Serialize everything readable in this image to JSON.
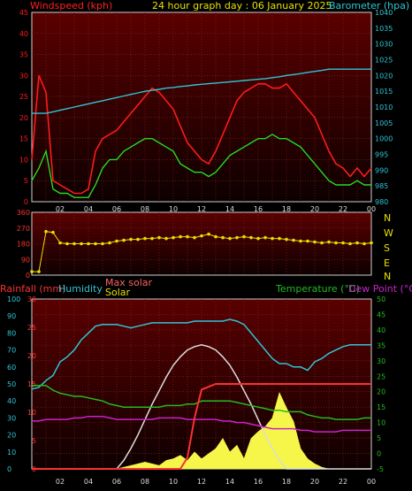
{
  "header": {
    "left_title": "Windspeed (kph)",
    "center_title": "24 hour graph day : 06 January 2025",
    "right_title": "Barometer (hpa)"
  },
  "colors": {
    "wind_gust": "#ff1a1a",
    "wind_avg": "#22dd22",
    "barometer": "#2fc4d4",
    "direction": "#e8e000",
    "rain": "#ff3030",
    "humidity": "#2fc4d4",
    "max_solar": "#dddddd",
    "solar": "#f5f54a",
    "temperature": "#22bb22",
    "dewpoint": "#cc22cc",
    "panel_top": "#5a0000",
    "panel_bottom": "#0d0000"
  },
  "time_axis": {
    "labels": [
      "02",
      "04",
      "06",
      "08",
      "10",
      "12",
      "14",
      "16",
      "18",
      "20",
      "22",
      "00"
    ]
  },
  "panel_wind": {
    "left_ticks": [
      "45",
      "40",
      "35",
      "30",
      "25",
      "20",
      "15",
      "10",
      "5",
      "0"
    ],
    "right_ticks": [
      "1040",
      "1035",
      "1030",
      "1025",
      "1020",
      "1015",
      "1010",
      "1005",
      "1000",
      "995",
      "990",
      "985",
      "980"
    ]
  },
  "panel_direction": {
    "left_ticks": [
      "360",
      "270",
      "180",
      "90",
      "0"
    ],
    "compass": [
      "N",
      "W",
      "S",
      "E",
      "N"
    ]
  },
  "panel_lower": {
    "labels": {
      "rainfall": "Rainfall (mm)",
      "humidity": "Humidity",
      "max_solar": "Max solar",
      "solar": "Solar",
      "temperature": "Temperature (°C)",
      "dewpoint": "Dew Point (°C)"
    },
    "humidity_ticks": [
      "100",
      "90",
      "80",
      "70",
      "60",
      "50",
      "40",
      "30",
      "20",
      "10",
      "0"
    ],
    "rain_ticks": [
      "30",
      "25",
      "20",
      "15",
      "10",
      "5",
      "0"
    ],
    "temp_ticks": [
      "50",
      "45",
      "40",
      "35",
      "30",
      "25",
      "20",
      "15",
      "10",
      "5",
      "0",
      "-5"
    ]
  },
  "chart_data": [
    {
      "type": "line",
      "title": "Windspeed (kph) / Barometer (hpa)",
      "x_hours": [
        0,
        0.5,
        1,
        1.5,
        2,
        2.5,
        3,
        3.5,
        4,
        4.5,
        5,
        5.5,
        6,
        6.5,
        7,
        7.5,
        8,
        8.5,
        9,
        9.5,
        10,
        10.5,
        11,
        11.5,
        12,
        12.5,
        13,
        13.5,
        14,
        14.5,
        15,
        15.5,
        16,
        16.5,
        17,
        17.5,
        18,
        18.5,
        19,
        19.5,
        20,
        20.5,
        21,
        21.5,
        22,
        22.5,
        23,
        23.5,
        24
      ],
      "series": [
        {
          "name": "Wind gust",
          "axis": "left",
          "values": [
            10,
            30,
            26,
            5,
            4,
            3,
            2,
            2,
            3,
            12,
            15,
            16,
            17,
            19,
            21,
            23,
            25,
            27,
            26,
            24,
            22,
            18,
            14,
            12,
            10,
            9,
            12,
            16,
            20,
            24,
            26,
            27,
            28,
            28,
            27,
            27,
            28,
            26,
            24,
            22,
            20,
            16,
            12,
            9,
            8,
            6,
            8,
            6,
            8
          ]
        },
        {
          "name": "Wind average",
          "axis": "left",
          "values": [
            5,
            8,
            12,
            3,
            2,
            2,
            1,
            1,
            1,
            4,
            8,
            10,
            10,
            12,
            13,
            14,
            15,
            15,
            14,
            13,
            12,
            9,
            8,
            7,
            7,
            6,
            7,
            9,
            11,
            12,
            13,
            14,
            15,
            15,
            16,
            15,
            15,
            14,
            13,
            11,
            9,
            7,
            5,
            4,
            4,
            4,
            5,
            4,
            4
          ]
        },
        {
          "name": "Barometer",
          "axis": "right",
          "values": [
            1008,
            1008,
            1008,
            1008.5,
            1009,
            1009.5,
            1010,
            1010.5,
            1011,
            1011.5,
            1012,
            1012.5,
            1013,
            1013.5,
            1014,
            1014.5,
            1015,
            1015.3,
            1015.6,
            1016,
            1016.2,
            1016.5,
            1016.7,
            1017,
            1017.2,
            1017.4,
            1017.6,
            1017.8,
            1018,
            1018.2,
            1018.4,
            1018.6,
            1018.8,
            1019,
            1019.3,
            1019.6,
            1020,
            1020.3,
            1020.6,
            1021,
            1021.3,
            1021.6,
            1022,
            1022,
            1022,
            1022,
            1022,
            1022,
            1022
          ]
        }
      ],
      "ylim_left": [
        0,
        45
      ],
      "ylim_right": [
        980,
        1040
      ]
    },
    {
      "type": "scatter",
      "title": "Wind direction",
      "x_hours": [
        0,
        0.5,
        1,
        1.5,
        2,
        2.5,
        3,
        3.5,
        4,
        4.5,
        5,
        5.5,
        6,
        6.5,
        7,
        7.5,
        8,
        8.5,
        9,
        9.5,
        10,
        10.5,
        11,
        11.5,
        12,
        12.5,
        13,
        13.5,
        14,
        14.5,
        15,
        15.5,
        16,
        16.5,
        17,
        17.5,
        18,
        18.5,
        19,
        19.5,
        20,
        20.5,
        21,
        21.5,
        22,
        22.5,
        23,
        23.5,
        24
      ],
      "values": [
        20,
        20,
        250,
        245,
        185,
        180,
        180,
        180,
        180,
        180,
        180,
        185,
        195,
        200,
        205,
        205,
        210,
        210,
        215,
        210,
        215,
        220,
        220,
        215,
        225,
        235,
        220,
        215,
        210,
        215,
        220,
        215,
        210,
        215,
        210,
        210,
        205,
        200,
        195,
        195,
        190,
        185,
        190,
        185,
        185,
        180,
        185,
        180,
        185
      ],
      "ylim": [
        0,
        360
      ]
    },
    {
      "type": "line",
      "title": "Rainfall / Humidity / Solar / Temperature / Dew Point",
      "x_hours": [
        0,
        0.5,
        1,
        1.5,
        2,
        2.5,
        3,
        3.5,
        4,
        4.5,
        5,
        5.5,
        6,
        6.5,
        7,
        7.5,
        8,
        8.5,
        9,
        9.5,
        10,
        10.5,
        11,
        11.5,
        12,
        12.5,
        13,
        13.5,
        14,
        14.5,
        15,
        15.5,
        16,
        16.5,
        17,
        17.5,
        18,
        18.5,
        19,
        19.5,
        20,
        20.5,
        21,
        21.5,
        22,
        22.5,
        23,
        23.5,
        24
      ],
      "series": [
        {
          "name": "Humidity",
          "axis": "humidity",
          "values": [
            47,
            48,
            52,
            55,
            63,
            66,
            70,
            76,
            80,
            84,
            85,
            85,
            85,
            84,
            83,
            84,
            85,
            86,
            86,
            86,
            86,
            86,
            86,
            87,
            87,
            87,
            87,
            87,
            88,
            87,
            85,
            80,
            75,
            70,
            65,
            62,
            62,
            60,
            60,
            58,
            63,
            65,
            68,
            70,
            72,
            73,
            73,
            73,
            73
          ]
        },
        {
          "name": "Temperature",
          "axis": "temperature",
          "values": [
            22,
            22,
            22,
            20.5,
            19.5,
            19,
            18.5,
            18.5,
            18,
            17.5,
            17,
            16,
            15.5,
            15,
            15,
            15,
            15,
            15,
            15,
            15.5,
            15.5,
            15.5,
            16,
            16,
            17,
            17,
            17,
            17,
            17,
            16.5,
            16,
            15.5,
            15,
            14.5,
            14,
            14,
            13.5,
            13.5,
            13.5,
            12.5,
            12,
            11.5,
            11.5,
            11,
            11,
            11,
            11,
            11.5,
            11.5
          ]
        },
        {
          "name": "Dew Point",
          "axis": "temperature",
          "values": [
            10.5,
            10.5,
            11,
            11,
            11,
            11,
            11.5,
            11.5,
            12,
            12,
            12,
            11.5,
            11,
            11,
            11,
            11,
            11,
            11,
            11.5,
            11.5,
            11.5,
            11.5,
            11,
            11,
            11,
            11,
            11,
            10.5,
            10.5,
            10,
            10,
            9.5,
            9,
            8.5,
            8,
            8,
            8,
            8,
            7.5,
            7.5,
            7,
            7,
            7,
            7,
            7.5,
            7.5,
            7.5,
            7.5,
            7.5
          ]
        },
        {
          "name": "Rainfall",
          "axis": "rain",
          "values": [
            0,
            0,
            0,
            0,
            0,
            0,
            0,
            0,
            0,
            0,
            0,
            0,
            0,
            0,
            0,
            0,
            0,
            0,
            0,
            0,
            0,
            0,
            2,
            9,
            14,
            14.5,
            15,
            15,
            15,
            15,
            15,
            15,
            15,
            15,
            15,
            15,
            15,
            15,
            15,
            15,
            15,
            15,
            15,
            15,
            15,
            15,
            15,
            15,
            15
          ]
        },
        {
          "name": "Max solar",
          "axis": "humidity",
          "values": [
            0,
            0,
            0,
            0,
            0,
            0,
            0,
            0,
            0,
            0,
            0,
            0,
            0,
            5,
            12,
            20,
            29,
            38,
            46,
            54,
            61,
            66,
            70,
            72,
            73,
            72,
            70,
            66,
            61,
            54,
            46,
            38,
            29,
            20,
            12,
            5,
            0,
            0,
            0,
            0,
            0,
            0,
            0,
            0,
            0,
            0,
            0,
            0,
            0
          ]
        },
        {
          "name": "Solar",
          "axis": "humidity",
          "values": [
            0,
            0,
            0,
            0,
            0,
            0,
            0,
            0,
            0,
            0,
            0,
            0,
            0,
            1,
            2,
            3,
            4,
            3,
            2,
            5,
            6,
            8,
            5,
            10,
            6,
            9,
            12,
            18,
            10,
            14,
            6,
            18,
            22,
            25,
            30,
            45,
            36,
            28,
            12,
            6,
            3,
            1,
            0,
            0,
            0,
            0,
            0,
            0,
            0
          ]
        }
      ],
      "ylim_humidity": [
        0,
        100
      ],
      "ylim_rain": [
        0,
        30
      ],
      "ylim_temperature": [
        -5,
        50
      ]
    }
  ]
}
